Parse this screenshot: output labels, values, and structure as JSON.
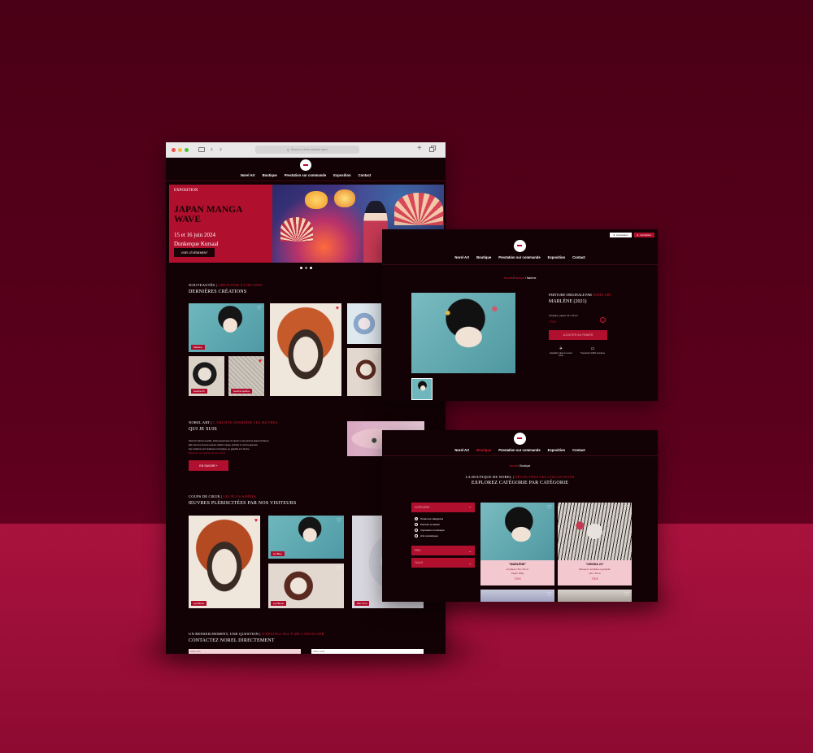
{
  "browser": {
    "address_placeholder": "Search or enter website name"
  },
  "nav": [
    "Norel Art",
    "Boutique",
    "Prestation sur commande",
    "Exposition",
    "Contact"
  ],
  "hero": {
    "kicker": "EXPOSITION",
    "title": "JAPAN MANGA WAVE",
    "dates": "15 et 16 juin 2024",
    "place": "Dunkerque Kursaal",
    "button": "VOIR L'ÉVÉNEMENT"
  },
  "news": {
    "kicker": "NOUVEAUTÉS",
    "kicker_red": "CRÉATIONS ET ŒUVRES",
    "title": "DERNIÈRES CRÉATIONS",
    "tags": [
      "Marlene",
      "Geisha 23",
      "Geisha Geisha"
    ]
  },
  "about": {
    "kicker": "NOREL ART",
    "kicker_red": "L'ARTISTE DERRIÈRE LES ŒUVRES",
    "title": "QUI JE SUIS",
    "lines": [
      "Norel Art (Norel Leveillé), artiste passionnée de dessin et de peinture depuis l'enfance.",
      "Elle crée des œuvres uniques mêlant manga, portraits et univers japonais.",
      "Ses créations sont réalisées à l'acrylique, au graphite et à l'encre.",
      "Découvrez son parcours et son univers."
    ],
    "button": "EN SAVOIR +"
  },
  "favorites": {
    "kicker": "COUPS DE CŒUR",
    "kicker_red": "LES PLUS AIMÉES",
    "title": "ŒUVRES PLÉBISCITÉES PAR NOS VISITEURS",
    "tags": [
      "Lys Bleue",
      "Liz Blue",
      "Lys Bleue",
      "Mei Yuna"
    ]
  },
  "contact": {
    "kicker": "UN RENSEIGNEMENT, UNE QUESTION",
    "kicker_red": "N'HÉSITEZ PAS À ME CONTACTER",
    "title": "CONTACTEZ NOREL DIRECTEMENT",
    "field1": "Votre nom",
    "field2": "Votre email"
  },
  "product": {
    "account_btns": [
      "Connexion",
      "Inscription"
    ],
    "breadcrumb": [
      "Accueil",
      "Boutique",
      "Marlène"
    ],
    "kicker": "PEINTURE ORIGINALE PAR",
    "kicker_red": "NOREL ART",
    "name": "MARLÈNE (2021)",
    "specs": "Acrylique, papier, 30 x 40 cm",
    "price": "770 €",
    "add_button": "AJOUTER AU PANIER",
    "feat1": "Expédition dans le monde entier",
    "feat2": "Transaction 100% sécurisée"
  },
  "shop": {
    "breadcrumb": [
      "Accueil",
      "Boutique"
    ],
    "kicker": "LA BOUTIQUE DE NOREL",
    "kicker_red": "DÉCOUVREZ LES COLLECTIONS",
    "title": "EXPLOREZ CATÉGORIE PAR CATÉGORIE",
    "filters": [
      "CATÉGORIE",
      "PRIX",
      "TAILLE"
    ],
    "options": [
      "Toutes les catégories",
      "Peinture et dessin",
      "Impression numérique",
      "Arts numériques"
    ],
    "products": [
      {
        "name": "\"MARLÈNE\"",
        "desc": "Acrylique | 30 x 40 cm",
        "sub": "Papier 300g",
        "price": "770 €"
      },
      {
        "name": "\"GEISHA 23\"",
        "desc": "Marqueur, acrylique et graphite",
        "sub": "| 30 x 40 cm",
        "price": "770 €"
      }
    ]
  },
  "colors": {
    "accent": "#b0102e",
    "background": "#120205"
  }
}
